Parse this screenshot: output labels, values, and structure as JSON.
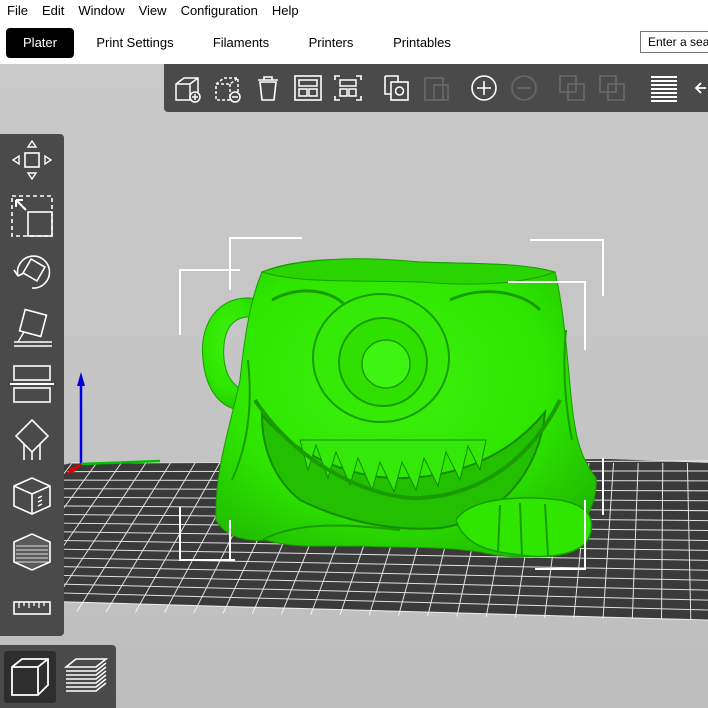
{
  "menu": [
    "File",
    "Edit",
    "Window",
    "View",
    "Configuration",
    "Help"
  ],
  "tabs": [
    {
      "label": "Plater",
      "active": true
    },
    {
      "label": "Print Settings",
      "active": false
    },
    {
      "label": "Filaments",
      "active": false
    },
    {
      "label": "Printers",
      "active": false
    },
    {
      "label": "Printables",
      "active": false
    }
  ],
  "search": {
    "placeholder": "Enter a search term"
  },
  "colors": {
    "model": "#2ee600",
    "toolbar": "#4a4a4a",
    "selection_box": "#ffffff",
    "bed_grid": "#ffffff",
    "axis_x": "#e00000",
    "axis_y": "#00c000",
    "axis_z": "#0000e0"
  },
  "top_toolbar": [
    "add-object-icon",
    "delete-object-icon",
    "delete-all-icon",
    "arrange-icon",
    "arrange-selection-icon",
    "copy-icon",
    "paste-icon",
    "add-instance-icon",
    "remove-instance-icon",
    "split-objects-icon",
    "split-parts-icon",
    "variable-layer-height-icon",
    "undo-icon"
  ],
  "left_toolbar": [
    "move-icon",
    "scale-icon",
    "rotate-icon",
    "place-on-face-icon",
    "cut-icon",
    "paint-supports-icon",
    "seam-painting-icon",
    "mmu-painting-icon",
    "measure-icon"
  ],
  "view_toolbar": [
    {
      "icon": "3d-view-icon",
      "active": true
    },
    {
      "icon": "preview-layers-icon",
      "active": false
    }
  ],
  "model": {
    "name": "cyclops-mug",
    "selected": true
  }
}
